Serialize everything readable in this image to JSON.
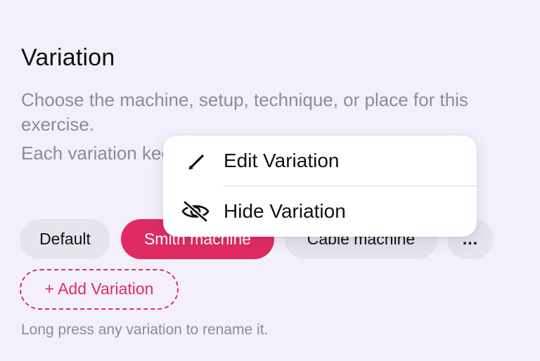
{
  "section": {
    "title": "Variation",
    "description_1": "Choose the machine, setup, technique, or place for this exercise.",
    "description_2": "Each variation keeps its own history and progress."
  },
  "variations": {
    "chips": [
      {
        "label": "Default",
        "selected": false
      },
      {
        "label": "Smith machine",
        "selected": true
      },
      {
        "label": "Cable machine",
        "selected": false
      },
      {
        "label": "...",
        "selected": false
      }
    ],
    "add_label": "+ Add Variation",
    "hint": "Long press any variation to rename it."
  },
  "context_menu": {
    "items": [
      {
        "label": "Edit Variation",
        "icon": "pencil-icon"
      },
      {
        "label": "Hide Variation",
        "icon": "eye-slash-icon"
      }
    ]
  },
  "colors": {
    "background": "#f3f0fb",
    "accent": "#e02b63",
    "chip_background": "#e7e4ed",
    "secondary_text": "#8e8b96"
  }
}
